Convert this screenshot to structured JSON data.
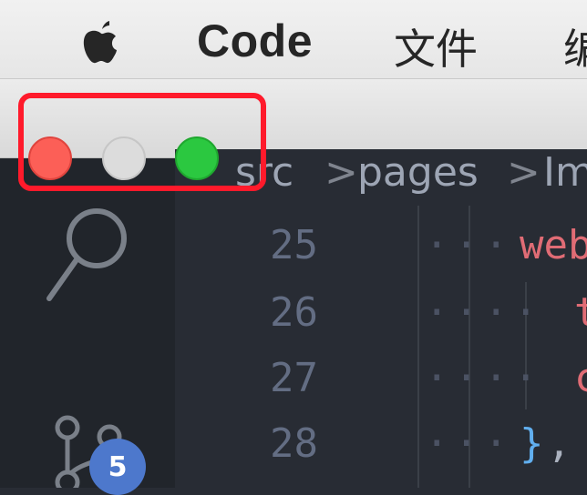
{
  "menubar": {
    "app_name": "Code",
    "items": [
      "文件",
      "编"
    ]
  },
  "window": {
    "traffic_lights": [
      "close",
      "minimize",
      "maximize"
    ]
  },
  "breadcrumb": {
    "segments": [
      "src",
      "pages",
      "Im"
    ],
    "separator": ">"
  },
  "activity_bar": {
    "scm_badge": "5"
  },
  "editor": {
    "lines": [
      {
        "number": "25",
        "text": "web"
      },
      {
        "number": "26",
        "text": "t"
      },
      {
        "number": "27",
        "text": "c"
      },
      {
        "number": "28",
        "text_brace": "}",
        "text_comma": ","
      }
    ]
  },
  "colors": {
    "highlight": "#ff1a2b",
    "badge": "#4d78cc",
    "close": "#fc5f57",
    "maximize": "#2bc840"
  }
}
